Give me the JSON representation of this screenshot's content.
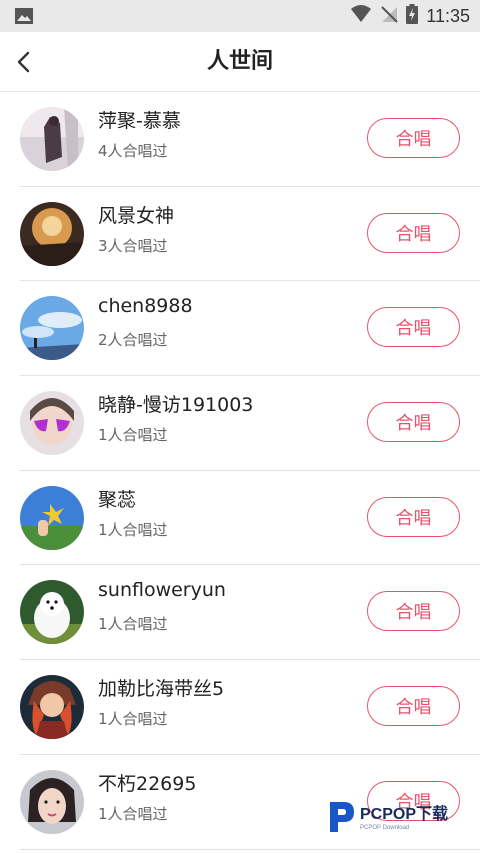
{
  "status": {
    "time": "11:35"
  },
  "header": {
    "title": "人世间"
  },
  "colors": {
    "accent": "#e8536b",
    "divider": "#e3e3e3",
    "status_bg": "#e9e9e9"
  },
  "items": [
    {
      "name": "萍聚-慕慕",
      "count": "4人合唱过",
      "button": "合唱"
    },
    {
      "name": "风景女神",
      "count": "3人合唱过",
      "button": "合唱"
    },
    {
      "name": "chen8988",
      "count": "2人合唱过",
      "button": "合唱"
    },
    {
      "name": "晓静-慢访191003",
      "count": "1人合唱过",
      "button": "合唱"
    },
    {
      "name": "聚蕊",
      "count": "1人合唱过",
      "button": "合唱"
    },
    {
      "name": "sunfloweryun",
      "count": "1人合唱过",
      "button": "合唱"
    },
    {
      "name": "加勒比海带丝5",
      "count": "1人合唱过",
      "button": "合唱"
    },
    {
      "name": "不朽22695",
      "count": "1人合唱过",
      "button": "合唱"
    }
  ],
  "watermark": {
    "main": "PCPOP下载",
    "sub": "PCPOP Download"
  }
}
